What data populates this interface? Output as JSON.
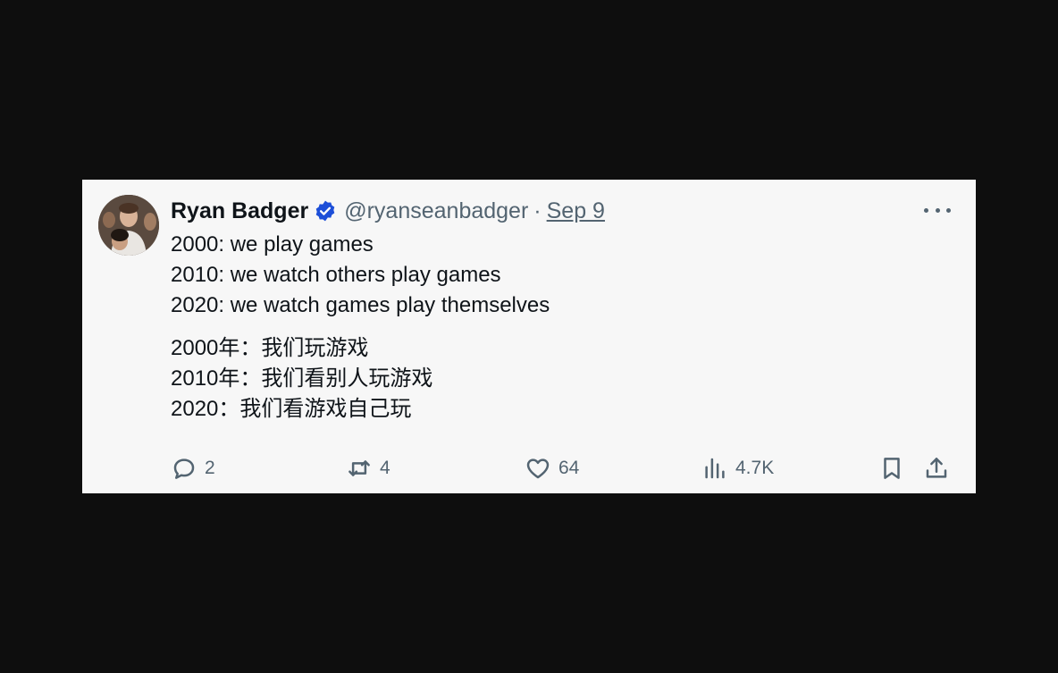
{
  "tweet": {
    "author_name": "Ryan Badger",
    "handle": "@ryanseanbadger",
    "separator": "·",
    "date": "Sep 9",
    "verified_color": "#1d4fd8",
    "lines_en": [
      "2000: we play games",
      "2010: we watch others play games",
      "2020: we watch games play themselves"
    ],
    "lines_zh": [
      "2000年：我们玩游戏",
      "2010年：我们看别人玩游戏",
      "2020：我们看游戏自己玩"
    ]
  },
  "actions": {
    "replies": "2",
    "retweets": "4",
    "likes": "64",
    "views": "4.7K"
  },
  "icons": {
    "more": "more-horizontal-icon",
    "reply": "reply-icon",
    "retweet": "retweet-icon",
    "like": "heart-icon",
    "views": "views-chart-icon",
    "bookmark": "bookmark-icon",
    "share": "share-icon"
  }
}
